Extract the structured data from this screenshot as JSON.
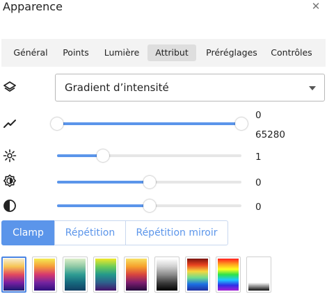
{
  "window": {
    "title": "Apparence",
    "close_icon": "close-icon"
  },
  "tabs": [
    {
      "label": "Général",
      "active": false
    },
    {
      "label": "Points",
      "active": false
    },
    {
      "label": "Lumière",
      "active": false
    },
    {
      "label": "Attribut",
      "active": true
    },
    {
      "label": "Préréglages",
      "active": false
    },
    {
      "label": "Contrôles",
      "active": false
    }
  ],
  "attribute": {
    "icon": "layers-icon",
    "select_value": "Gradient d’intensité"
  },
  "range": {
    "icon": "trend-line-icon",
    "min_value": "0",
    "max_value": "65280",
    "low_fraction": 0.0,
    "high_fraction": 1.0
  },
  "brightness": {
    "icon": "brightness-icon",
    "value": "1",
    "fraction": 0.25
  },
  "gamma": {
    "icon": "contrast-gear-icon",
    "value": "0",
    "fraction": 0.5
  },
  "contrast": {
    "icon": "contrast-half-icon",
    "value": "0",
    "fraction": 0.5
  },
  "wrap_mode": {
    "buttons": [
      {
        "label": "Clamp",
        "active": true
      },
      {
        "label": "Répétition",
        "active": false
      },
      {
        "label": "Répétition miroir",
        "active": false
      }
    ]
  },
  "colormaps": [
    {
      "name": "warm-colormap",
      "selected": true,
      "stops": [
        "#f7eecf",
        "#f6c453",
        "#e3495e",
        "#7a1fa2",
        "#1a1a72"
      ]
    },
    {
      "name": "sunset-colormap",
      "selected": false,
      "stops": [
        "#f4ec52",
        "#f59a3a",
        "#d6386e",
        "#7424a0",
        "#2f0f7c"
      ]
    },
    {
      "name": "teal-colormap",
      "selected": false,
      "stops": [
        "#dbeec8",
        "#8dc8a4",
        "#2e9c93",
        "#166a7e",
        "#123f63"
      ]
    },
    {
      "name": "viridis-colormap",
      "selected": false,
      "stops": [
        "#f0e72a",
        "#6ccc59",
        "#23998b",
        "#2e5f8c",
        "#43126a"
      ]
    },
    {
      "name": "inferno-colormap",
      "selected": false,
      "stops": [
        "#f7e063",
        "#f6a02c",
        "#d8453f",
        "#7e1d6f",
        "#240b3c"
      ]
    },
    {
      "name": "grayscale-colormap",
      "selected": false,
      "stops": [
        "#ffffff",
        "#cfcfcf",
        "#8c8c8c",
        "#3e3e3e",
        "#000000"
      ]
    },
    {
      "name": "jet-colormap",
      "selected": false,
      "stops": [
        "#7c1410",
        "#e9421f",
        "#f6d63d",
        "#6fdc8e",
        "#1b6fe3",
        "#1f2fa0"
      ]
    },
    {
      "name": "rainbow-colormap",
      "selected": false,
      "stops": [
        "#ff1f1f",
        "#ff9a1f",
        "#ffff1f",
        "#2ee24a",
        "#1ec9ff",
        "#2f2fe6",
        "#a51fd6"
      ]
    },
    {
      "name": "white-black-colormap",
      "selected": false,
      "stops": [
        "#ffffff",
        "#ffffff",
        "#ffffff",
        "#ffffff",
        "#111111"
      ]
    }
  ]
}
